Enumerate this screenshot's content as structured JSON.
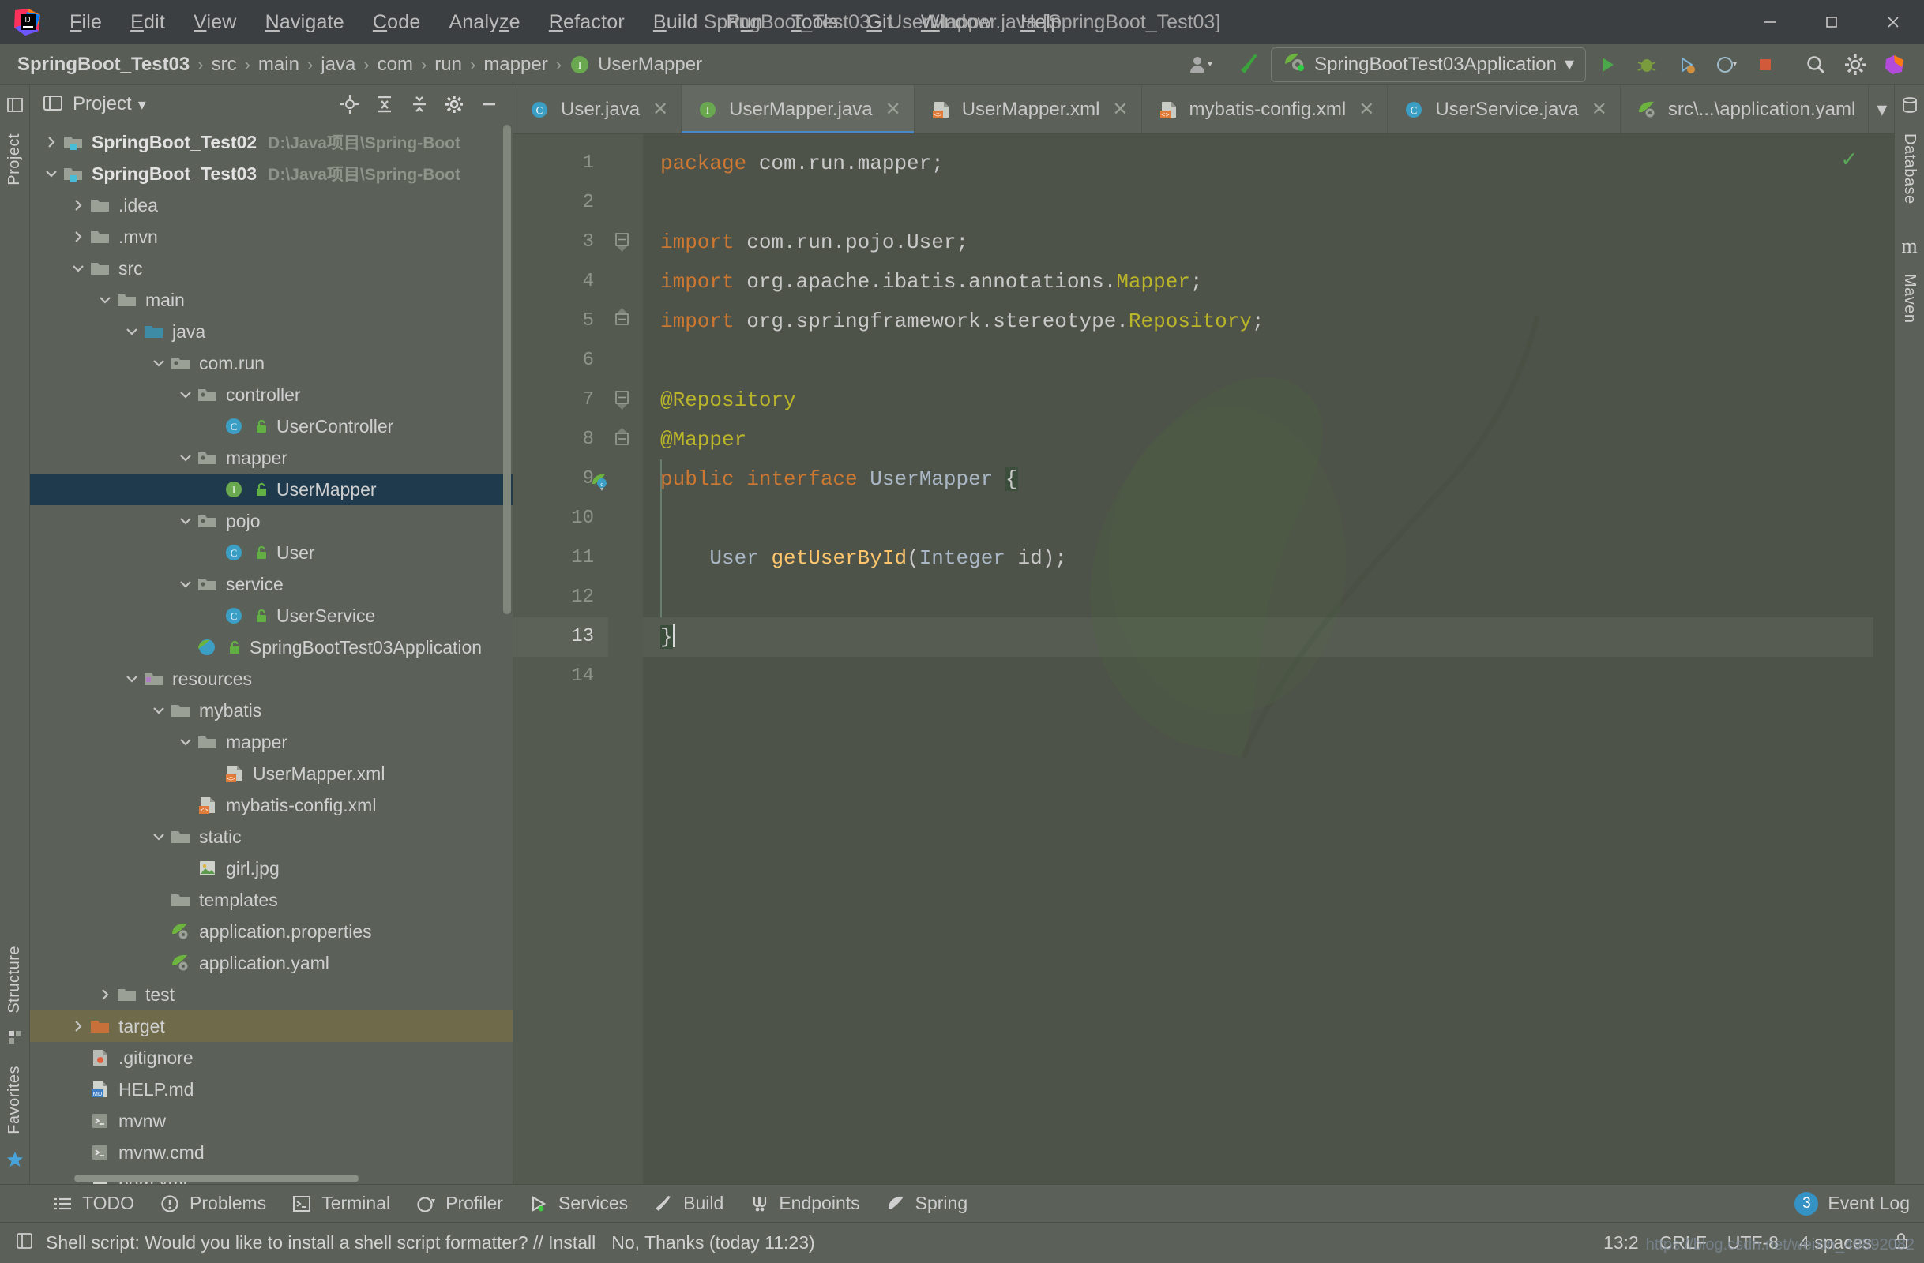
{
  "window": {
    "title": "SpringBoot_Test03 - UserMapper.java [SpringBoot_Test03]",
    "minimize": "─",
    "maximize": "❐",
    "close": "✕"
  },
  "menubar": {
    "items": [
      {
        "label": "File",
        "mnemonic": "F"
      },
      {
        "label": "Edit",
        "mnemonic": "E"
      },
      {
        "label": "View",
        "mnemonic": "V"
      },
      {
        "label": "Navigate",
        "mnemonic": "N"
      },
      {
        "label": "Code",
        "mnemonic": "C"
      },
      {
        "label": "Analyze",
        "mnemonic": "z"
      },
      {
        "label": "Refactor",
        "mnemonic": "R"
      },
      {
        "label": "Build",
        "mnemonic": "B"
      },
      {
        "label": "Run",
        "mnemonic": "u"
      },
      {
        "label": "Tools",
        "mnemonic": "T"
      },
      {
        "label": "Git",
        "mnemonic": "G"
      },
      {
        "label": "Window",
        "mnemonic": "W"
      },
      {
        "label": "Help",
        "mnemonic": "H"
      }
    ]
  },
  "navbar": {
    "breadcrumbs": [
      "SpringBoot_Test03",
      "src",
      "main",
      "java",
      "com",
      "run",
      "mapper",
      "UserMapper"
    ],
    "separator": "›",
    "class_badge": "I",
    "run_config": "SpringBootTest03Application",
    "dropdown_caret": "▾"
  },
  "project_panel": {
    "title": "Project",
    "title_caret": "▾",
    "tree": [
      {
        "depth": 0,
        "label": "SpringBoot_Test02",
        "path": "D:\\Java项目\\Spring-Boot",
        "icon": "module-folder-icon",
        "chevron": "collapsed",
        "bold": true
      },
      {
        "depth": 0,
        "label": "SpringBoot_Test03",
        "path": "D:\\Java项目\\Spring-Boot",
        "icon": "module-folder-icon",
        "chevron": "expanded",
        "bold": true
      },
      {
        "depth": 1,
        "label": ".idea",
        "icon": "folder-icon",
        "chevron": "collapsed"
      },
      {
        "depth": 1,
        "label": ".mvn",
        "icon": "folder-icon",
        "chevron": "collapsed"
      },
      {
        "depth": 1,
        "label": "src",
        "icon": "folder-icon",
        "chevron": "expanded"
      },
      {
        "depth": 2,
        "label": "main",
        "icon": "folder-icon",
        "chevron": "expanded"
      },
      {
        "depth": 3,
        "label": "java",
        "icon": "source-root-icon",
        "chevron": "expanded"
      },
      {
        "depth": 4,
        "label": "com.run",
        "icon": "package-icon",
        "chevron": "expanded"
      },
      {
        "depth": 5,
        "label": "controller",
        "icon": "package-icon",
        "chevron": "expanded"
      },
      {
        "depth": 6,
        "label": "UserController",
        "icon": "class-icon",
        "lock": true
      },
      {
        "depth": 5,
        "label": "mapper",
        "icon": "package-icon",
        "chevron": "expanded"
      },
      {
        "depth": 6,
        "label": "UserMapper",
        "icon": "interface-icon",
        "lock": true,
        "selected": true
      },
      {
        "depth": 5,
        "label": "pojo",
        "icon": "package-icon",
        "chevron": "expanded"
      },
      {
        "depth": 6,
        "label": "User",
        "icon": "class-icon",
        "lock": true
      },
      {
        "depth": 5,
        "label": "service",
        "icon": "package-icon",
        "chevron": "expanded"
      },
      {
        "depth": 6,
        "label": "UserService",
        "icon": "class-icon",
        "lock": true
      },
      {
        "depth": 5,
        "label": "SpringBootTest03Application",
        "icon": "spring-class-icon",
        "lock": true
      },
      {
        "depth": 3,
        "label": "resources",
        "icon": "resource-root-icon",
        "chevron": "expanded"
      },
      {
        "depth": 4,
        "label": "mybatis",
        "icon": "folder-icon",
        "chevron": "expanded"
      },
      {
        "depth": 5,
        "label": "mapper",
        "icon": "folder-icon",
        "chevron": "expanded"
      },
      {
        "depth": 6,
        "label": "UserMapper.xml",
        "icon": "xml-file-icon"
      },
      {
        "depth": 5,
        "label": "mybatis-config.xml",
        "icon": "xml-file-icon"
      },
      {
        "depth": 4,
        "label": "static",
        "icon": "folder-icon",
        "chevron": "expanded"
      },
      {
        "depth": 5,
        "label": "girl.jpg",
        "icon": "image-file-icon"
      },
      {
        "depth": 4,
        "label": "templates",
        "icon": "folder-icon"
      },
      {
        "depth": 4,
        "label": "application.properties",
        "icon": "spring-file-icon"
      },
      {
        "depth": 4,
        "label": "application.yaml",
        "icon": "spring-file-icon"
      },
      {
        "depth": 2,
        "label": "test",
        "icon": "folder-icon",
        "chevron": "collapsed"
      },
      {
        "depth": 1,
        "label": "target",
        "icon": "target-folder-icon",
        "chevron": "collapsed",
        "highlight": true
      },
      {
        "depth": 1,
        "label": ".gitignore",
        "icon": "gitignore-file-icon"
      },
      {
        "depth": 1,
        "label": "HELP.md",
        "icon": "markdown-file-icon"
      },
      {
        "depth": 1,
        "label": "mvnw",
        "icon": "script-file-icon"
      },
      {
        "depth": 1,
        "label": "mvnw.cmd",
        "icon": "script-file-icon"
      },
      {
        "depth": 1,
        "label": "pom.xml",
        "icon": "maven-file-icon"
      }
    ]
  },
  "left_strip": {
    "labels": [
      "Project",
      "Structure",
      "Favorites"
    ]
  },
  "right_strip": {
    "labels": [
      "Database",
      "Maven"
    ]
  },
  "editor": {
    "tabs": [
      {
        "label": "User.java",
        "icon": "java-class-icon",
        "active": false,
        "closable": true
      },
      {
        "label": "UserMapper.java",
        "icon": "java-interface-icon",
        "active": true,
        "closable": true
      },
      {
        "label": "UserMapper.xml",
        "icon": "xml-file-icon",
        "active": false,
        "closable": true
      },
      {
        "label": "mybatis-config.xml",
        "icon": "xml-file-icon",
        "active": false,
        "closable": true
      },
      {
        "label": "UserService.java",
        "icon": "java-class-icon",
        "active": false,
        "closable": true
      },
      {
        "label": "src\\...\\application.yaml",
        "icon": "spring-file-icon",
        "active": false,
        "closable": false
      }
    ],
    "tab_close_glyph": "✕",
    "tabs_overflow_glyph": "▾",
    "inspection_status": "✓",
    "current_line": 13,
    "lines": [
      {
        "n": 1,
        "html": "<span class=\"kw\">package</span> com.run.mapper;"
      },
      {
        "n": 2,
        "html": ""
      },
      {
        "n": 3,
        "html": "<span class=\"kw\">import</span> com.run.pojo.User;",
        "fold": "start"
      },
      {
        "n": 4,
        "html": "<span class=\"kw\">import</span> org.apache.ibatis.annotations.<span class=\"ann\">Mapper</span>;"
      },
      {
        "n": 5,
        "html": "<span class=\"kw\">import</span> org.springframework.stereotype.<span class=\"ann\">Repository</span>;",
        "fold": "end"
      },
      {
        "n": 6,
        "html": ""
      },
      {
        "n": 7,
        "html": "<span class=\"ann\">@Repository</span>",
        "fold": "start"
      },
      {
        "n": 8,
        "html": "<span class=\"ann\">@Mapper</span>",
        "fold": "mid"
      },
      {
        "n": 9,
        "html": "<span class=\"kw\">public</span> <span class=\"kw\">interface</span> <span class=\"typ\">UserMapper</span> <span class=\"brace-hl\">{</span>",
        "gutter_icon": "spring-bean-icon"
      },
      {
        "n": 10,
        "html": ""
      },
      {
        "n": 11,
        "html": "    <span class=\"typ\">User</span> <span class=\"mth\">getUserById</span>(<span class=\"typ\">Integer</span> id);"
      },
      {
        "n": 12,
        "html": ""
      },
      {
        "n": 13,
        "html": "<span class=\"brace-hl\">}</span>",
        "current": true
      },
      {
        "n": 14,
        "html": ""
      }
    ]
  },
  "toolwindow_bar": {
    "items": [
      {
        "label": "TODO",
        "icon": "todo-icon"
      },
      {
        "label": "Problems",
        "icon": "problems-icon"
      },
      {
        "label": "Terminal",
        "icon": "terminal-icon"
      },
      {
        "label": "Profiler",
        "icon": "profiler-icon"
      },
      {
        "label": "Services",
        "icon": "services-icon"
      },
      {
        "label": "Build",
        "icon": "build-hammer-icon"
      },
      {
        "label": "Endpoints",
        "icon": "endpoints-icon"
      },
      {
        "label": "Spring",
        "icon": "spring-leaf-icon"
      }
    ],
    "event_log": {
      "label": "Event Log",
      "count": "3"
    }
  },
  "statusbar": {
    "message": "Shell script: Would you like to install a shell script formatter? // Install",
    "action": "No, Thanks (today 11:23)",
    "caret_position": "13:2",
    "line_separator": "CRLF",
    "encoding": "UTF-8",
    "indent": "4 spaces",
    "watermark": "https://blog.csdn.net/weixin_49892082"
  },
  "colors": {
    "accent_blue": "#3592c4",
    "selection_blue": "#1f3a4d",
    "keyword_orange": "#cc7832",
    "annotation_yellow": "#bbb529",
    "method_gold": "#ffc66d",
    "spring_green": "#6db33f",
    "target_highlight": "#6e6a4a"
  }
}
